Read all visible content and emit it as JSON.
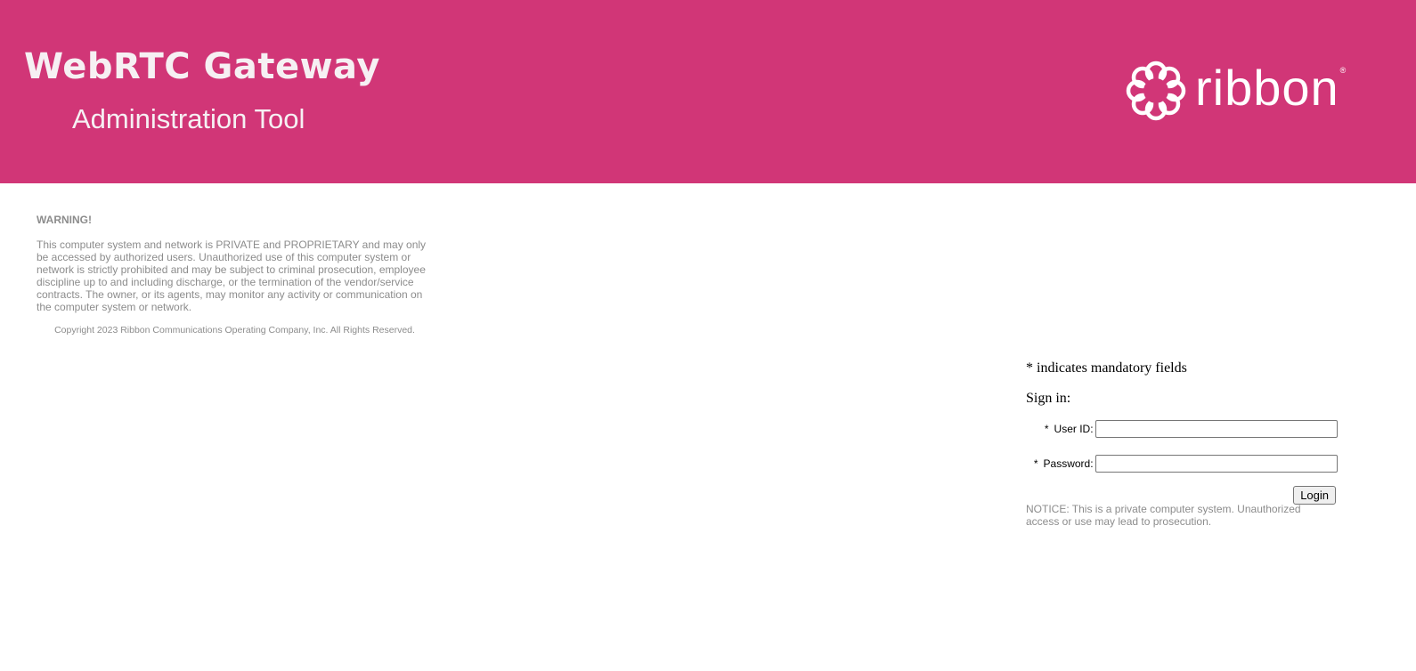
{
  "header": {
    "title": "WebRTC Gateway",
    "subtitle": "Administration Tool",
    "logo_text": "ribbon",
    "logo_mark": "®",
    "background_color": "#d13677"
  },
  "warning": {
    "title": "WARNING!",
    "text": "This computer system and network is PRIVATE and PROPRIETARY and may only be accessed by authorized users. Unauthorized use of this computer system or network is strictly prohibited and may be subject to criminal prosecution, employee discipline up to and including discharge, or the termination of the vendor/service contracts. The owner, or its agents, may monitor any activity or communication on the computer system or network.",
    "copyright": "Copyright 2023 Ribbon Communications Operating Company, Inc. All Rights Reserved."
  },
  "login": {
    "mandatory_note": "* indicates mandatory fields",
    "heading": "Sign in:",
    "required_marker": "*",
    "user_id_label": "User ID:",
    "user_id_value": "",
    "password_label": "Password:",
    "password_value": "",
    "button_label": "Login",
    "notice": "NOTICE: This is a private computer system. Unauthorized access or use may lead to prosecution."
  }
}
